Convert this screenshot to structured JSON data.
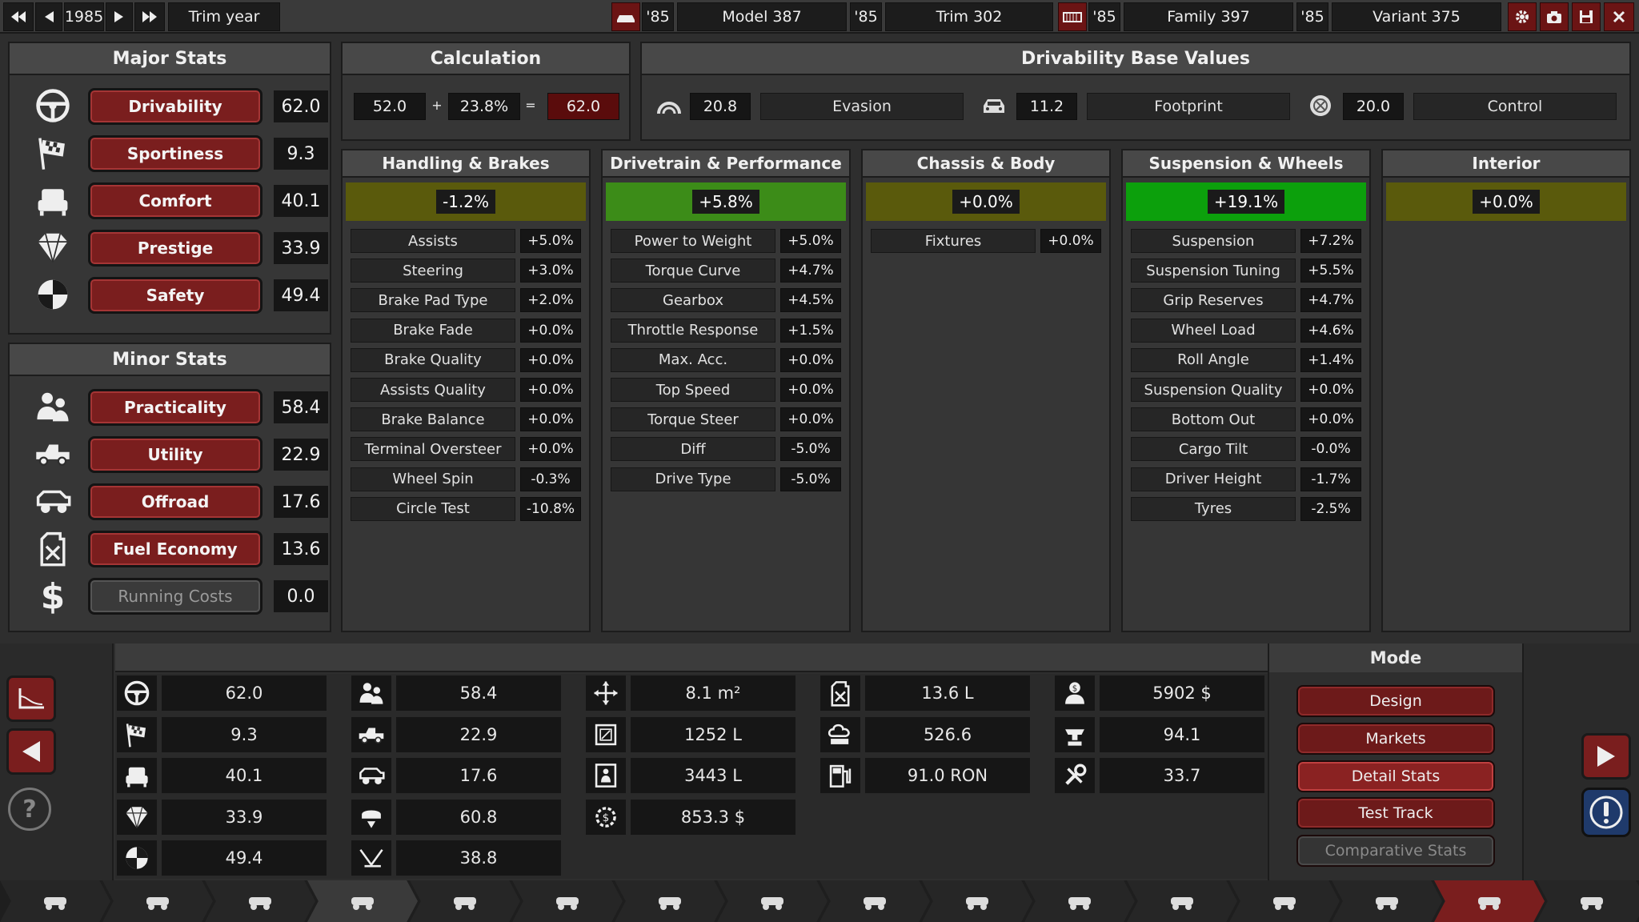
{
  "topbar": {
    "year": "1985",
    "trim_year_label": "Trim year",
    "model_year": "'85",
    "model": "Model 387",
    "trim_year": "'85",
    "trim": "Trim 302",
    "family_year": "'85",
    "family": "Family 397",
    "variant_year": "'85",
    "variant": "Variant 375"
  },
  "major": {
    "title": "Major Stats",
    "items": [
      {
        "label": "Drivability",
        "value": "62.0",
        "icon": "steering-wheel-icon"
      },
      {
        "label": "Sportiness",
        "value": "9.3",
        "icon": "race-flag-icon"
      },
      {
        "label": "Comfort",
        "value": "40.1",
        "icon": "seat-icon"
      },
      {
        "label": "Prestige",
        "value": "33.9",
        "icon": "diamond-icon"
      },
      {
        "label": "Safety",
        "value": "49.4",
        "icon": "crash-test-icon"
      }
    ]
  },
  "minor": {
    "title": "Minor Stats",
    "items": [
      {
        "label": "Practicality",
        "value": "58.4",
        "icon": "people-icon"
      },
      {
        "label": "Utility",
        "value": "22.9",
        "icon": "pickup-icon"
      },
      {
        "label": "Offroad",
        "value": "17.6",
        "icon": "offroad-icon"
      },
      {
        "label": "Fuel Economy",
        "value": "13.6",
        "icon": "fuel-can-icon"
      },
      {
        "label": "Running Costs",
        "value": "0.0",
        "icon": "dollar-icon"
      }
    ]
  },
  "calc": {
    "title": "Calculation",
    "a": "52.0",
    "plus": "+",
    "b": "23.8%",
    "eq": "=",
    "result": "62.0"
  },
  "base": {
    "title": "Drivability Base Values",
    "items": [
      {
        "value": "20.8",
        "label": "Evasion",
        "icon": "evasion-icon"
      },
      {
        "value": "11.2",
        "label": "Footprint",
        "icon": "car-front-icon"
      },
      {
        "value": "20.0",
        "label": "Control",
        "icon": "control-icon"
      }
    ]
  },
  "categories": [
    {
      "title": "Handling & Brakes",
      "total": "-1.2%",
      "bar": "#5a5a0c",
      "rows": [
        [
          "Assists",
          "+5.0%"
        ],
        [
          "Steering",
          "+3.0%"
        ],
        [
          "Brake Pad Type",
          "+2.0%"
        ],
        [
          "Brake Fade",
          "+0.0%"
        ],
        [
          "Brake Quality",
          "+0.0%"
        ],
        [
          "Assists Quality",
          "+0.0%"
        ],
        [
          "Brake Balance",
          "+0.0%"
        ],
        [
          "Terminal Oversteer",
          "+0.0%"
        ],
        [
          "Wheel Spin",
          "-0.3%"
        ],
        [
          "Circle Test",
          "-10.8%"
        ]
      ]
    },
    {
      "title": "Drivetrain & Performance",
      "total": "+5.8%",
      "bar": "#3c8c18",
      "rows": [
        [
          "Power to Weight",
          "+5.0%"
        ],
        [
          "Torque Curve",
          "+4.7%"
        ],
        [
          "Gearbox",
          "+4.5%"
        ],
        [
          "Throttle Response",
          "+1.5%"
        ],
        [
          "Max. Acc.",
          "+0.0%"
        ],
        [
          "Top Speed",
          "+0.0%"
        ],
        [
          "Torque Steer",
          "+0.0%"
        ],
        [
          "Diff",
          "-5.0%"
        ],
        [
          "Drive Type",
          "-5.0%"
        ]
      ]
    },
    {
      "title": "Chassis & Body",
      "total": "+0.0%",
      "bar": "#5a5a0c",
      "rows": [
        [
          "Fixtures",
          "+0.0%"
        ]
      ]
    },
    {
      "title": "Suspension & Wheels",
      "total": "+19.1%",
      "bar": "#0ca00c",
      "rows": [
        [
          "Suspension",
          "+7.2%"
        ],
        [
          "Suspension Tuning",
          "+5.5%"
        ],
        [
          "Grip Reserves",
          "+4.7%"
        ],
        [
          "Wheel Load",
          "+4.6%"
        ],
        [
          "Roll Angle",
          "+1.4%"
        ],
        [
          "Suspension Quality",
          "+0.0%"
        ],
        [
          "Bottom Out",
          "+0.0%"
        ],
        [
          "Cargo Tilt",
          "-0.0%"
        ],
        [
          "Driver Height",
          "-1.7%"
        ],
        [
          "Tyres",
          "-2.5%"
        ]
      ]
    },
    {
      "title": "Interior",
      "total": "+0.0%",
      "bar": "#5a5a0c",
      "rows": []
    }
  ],
  "summary": {
    "col1": [
      [
        "steering-wheel-icon",
        "62.0"
      ],
      [
        "race-flag-icon",
        "9.3"
      ],
      [
        "seat-icon",
        "40.1"
      ],
      [
        "diamond-icon",
        "33.9"
      ],
      [
        "crash-test-icon",
        "49.4"
      ]
    ],
    "col2": [
      [
        "people-icon",
        "58.4"
      ],
      [
        "pickup-icon",
        "22.9"
      ],
      [
        "offroad-icon",
        "17.6"
      ],
      [
        "cargo-icon",
        "60.8"
      ],
      [
        "reliability-icon",
        "38.8"
      ]
    ],
    "col3": [
      [
        "dimensions-icon",
        "8.1 m²"
      ],
      [
        "cargo-volume-icon",
        "1252 L"
      ],
      [
        "passenger-volume-icon",
        "3443 L"
      ],
      [
        "material-cost-icon",
        "853.3 $"
      ]
    ],
    "col4": [
      [
        "fuel-can-icon",
        "13.6 L"
      ],
      [
        "emissions-icon",
        "526.6"
      ],
      [
        "fuel-pump-icon",
        "91.0 RON"
      ]
    ],
    "col5": [
      [
        "cost-icon",
        "5902 $"
      ],
      [
        "production-icon",
        "94.1"
      ],
      [
        "engineering-icon",
        "33.7"
      ]
    ]
  },
  "mode": {
    "title": "Mode",
    "buttons": [
      "Design",
      "Markets",
      "Detail Stats",
      "Test Track",
      "Comparative Stats"
    ]
  },
  "nav": [
    "car-icon",
    "chassis-icon",
    "suspension-icon",
    "body-icon",
    "fixtures-icon",
    "aero-icon",
    "interior-icon",
    "brakes-icon",
    "wheels-icon",
    "tyres-icon",
    "drivetrain-icon",
    "steering-icon",
    "handling-icon",
    "paint-icon",
    "test-icon",
    "check-icon"
  ]
}
